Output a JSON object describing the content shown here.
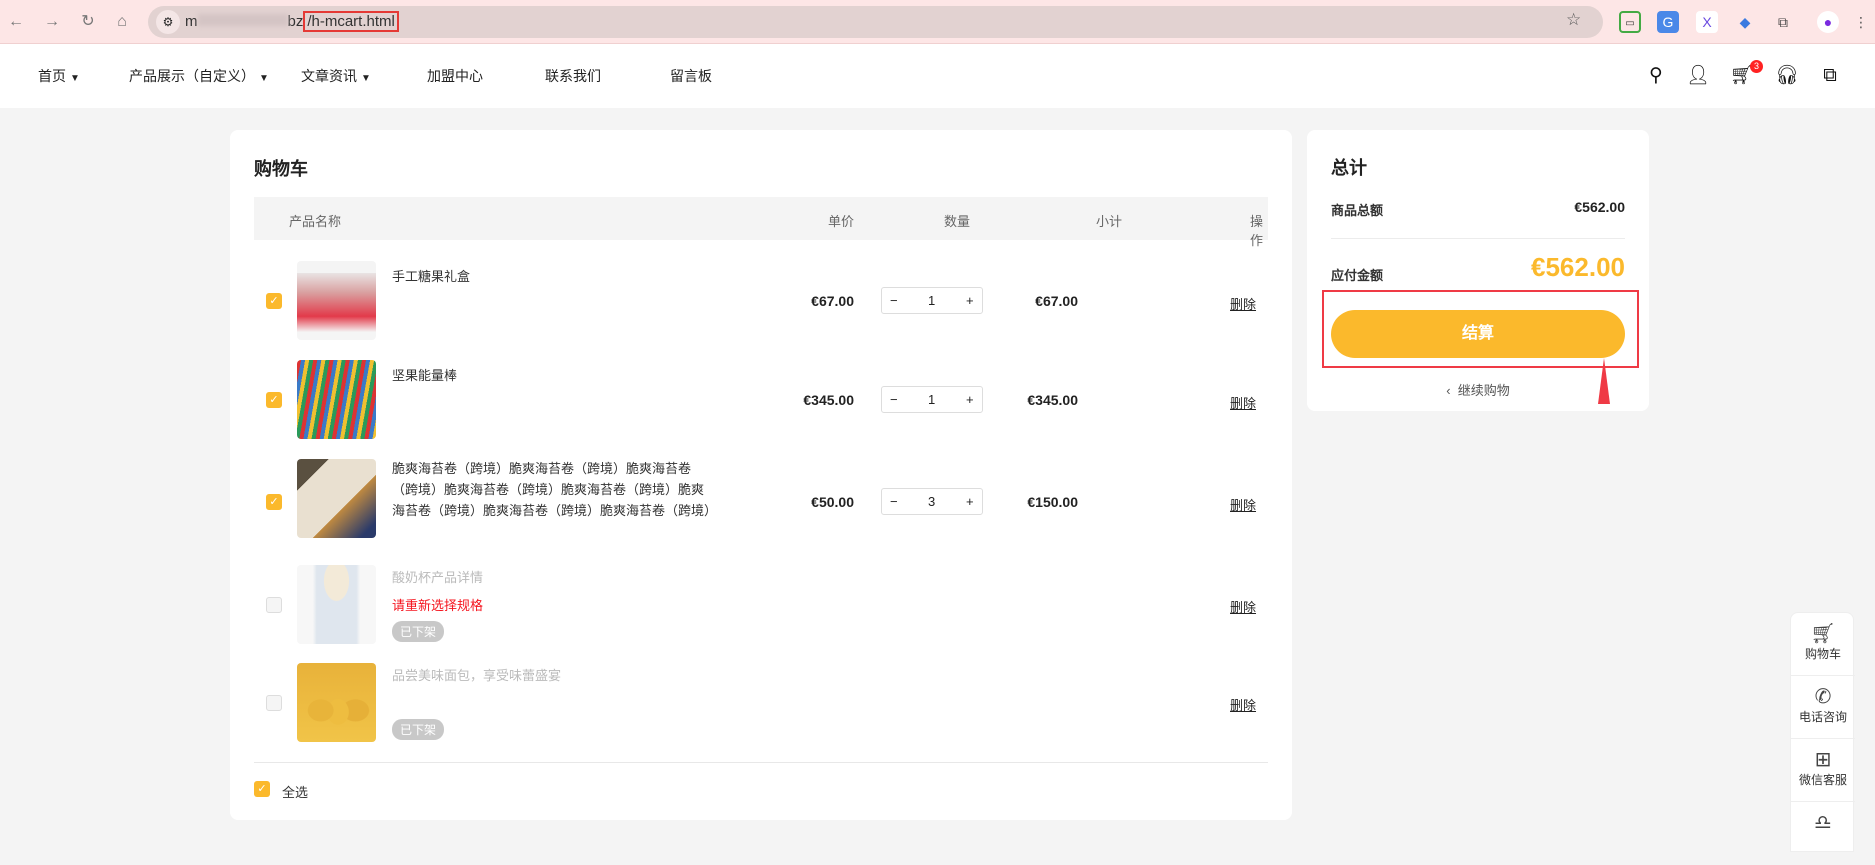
{
  "browser": {
    "url_prefix": "m",
    "url_host_tail": "bz",
    "url_path": "/h-mcart.html"
  },
  "nav": {
    "items": [
      {
        "label": "首页",
        "dropdown": true
      },
      {
        "label": "产品展示（自定义）",
        "dropdown": true
      },
      {
        "label": "文章资讯",
        "dropdown": true
      },
      {
        "label": "加盟中心"
      },
      {
        "label": "联系我们"
      },
      {
        "label": "留言板"
      }
    ],
    "cart_count": "3"
  },
  "cart": {
    "title": "购物车",
    "columns": {
      "name": "产品名称",
      "price": "单价",
      "qty": "数量",
      "subtotal": "小计",
      "action": "操作"
    },
    "items": [
      {
        "name": "手工糖果礼盒",
        "price": "€67.00",
        "qty": "1",
        "subtotal": "€67.00",
        "action": "删除",
        "checked": true
      },
      {
        "name": "坚果能量棒",
        "price": "€345.00",
        "qty": "1",
        "subtotal": "€345.00",
        "action": "删除",
        "checked": true
      },
      {
        "name": "脆爽海苔卷（跨境）脆爽海苔卷（跨境）脆爽海苔卷（跨境）脆爽海苔卷（跨境）脆爽海苔卷（跨境）脆爽海苔卷（跨境）脆爽海苔卷（跨境）脆爽海苔卷（跨境）",
        "price": "€50.00",
        "qty": "3",
        "subtotal": "€150.00",
        "action": "删除",
        "checked": true
      },
      {
        "name": "酸奶杯产品详情",
        "warning": "请重新选择规格",
        "status": "已下架",
        "action": "删除",
        "checked": false
      },
      {
        "name": "品尝美味面包，享受味蕾盛宴",
        "status": "已下架",
        "action": "删除",
        "checked": false
      }
    ],
    "select_all": "全选",
    "minus": "−",
    "plus": "+"
  },
  "summary": {
    "title": "总计",
    "goods_total_label": "商品总额",
    "goods_total": "€562.00",
    "payable_label": "应付金额",
    "payable": "€562.00",
    "checkout": "结算",
    "continue": "继续购物"
  },
  "float": {
    "items": [
      "购物车",
      "电话咨询",
      "微信客服"
    ]
  },
  "colors": {
    "accent": "#fbb92c",
    "warning": "#f5141e",
    "annotation": "#ef3a45"
  }
}
